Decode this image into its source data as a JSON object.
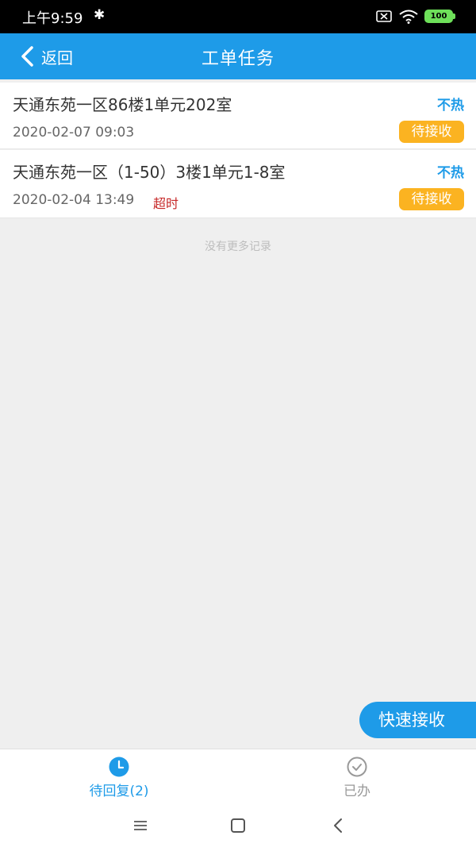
{
  "status_bar": {
    "time": "上午9:59",
    "bluetooth": "bluetooth-icon",
    "sim": "no-sim-icon",
    "wifi": "wifi-icon",
    "battery": "100"
  },
  "header": {
    "back_label": "返回",
    "title": "工单任务"
  },
  "work_orders": [
    {
      "address": "天通东苑一区86楼1单元202室",
      "heat_status": "不热",
      "datetime": "2020-02-07 09:03",
      "overtime": "",
      "status": "待接收"
    },
    {
      "address": "天通东苑一区（1-50）3楼1单元1-8室",
      "heat_status": "不热",
      "datetime": "2020-02-04 13:49",
      "overtime": "超时",
      "status": "待接收"
    }
  ],
  "list_footer": "没有更多记录",
  "quick_accept_label": "快速接收",
  "tabs": [
    {
      "label": "待回复(2)",
      "icon": "clock-icon",
      "active": true
    },
    {
      "label": "已办",
      "icon": "check-circle-icon",
      "active": false
    }
  ],
  "colors": {
    "primary": "#1e9be8",
    "badge": "#fbb321",
    "overtime": "#c62828",
    "background": "#efefef"
  }
}
